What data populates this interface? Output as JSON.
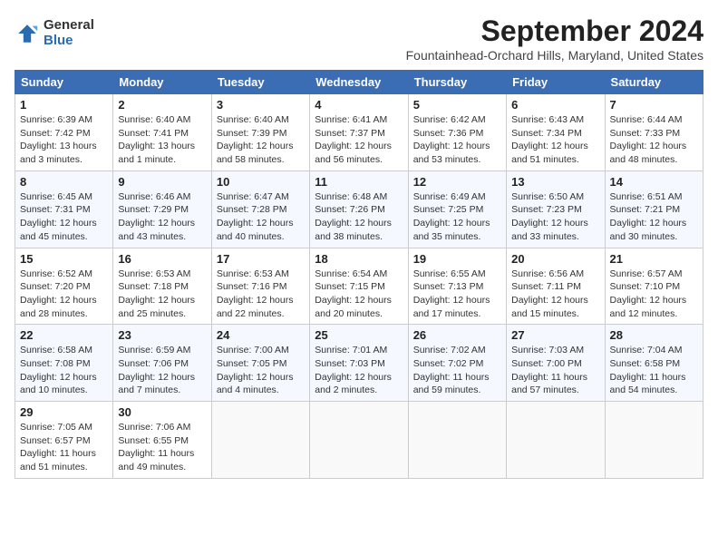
{
  "header": {
    "logo_general": "General",
    "logo_blue": "Blue",
    "title": "September 2024",
    "subtitle": "Fountainhead-Orchard Hills, Maryland, United States"
  },
  "days_of_week": [
    "Sunday",
    "Monday",
    "Tuesday",
    "Wednesday",
    "Thursday",
    "Friday",
    "Saturday"
  ],
  "weeks": [
    [
      {
        "day": "1",
        "info": "Sunrise: 6:39 AM\nSunset: 7:42 PM\nDaylight: 13 hours\nand 3 minutes."
      },
      {
        "day": "2",
        "info": "Sunrise: 6:40 AM\nSunset: 7:41 PM\nDaylight: 13 hours\nand 1 minute."
      },
      {
        "day": "3",
        "info": "Sunrise: 6:40 AM\nSunset: 7:39 PM\nDaylight: 12 hours\nand 58 minutes."
      },
      {
        "day": "4",
        "info": "Sunrise: 6:41 AM\nSunset: 7:37 PM\nDaylight: 12 hours\nand 56 minutes."
      },
      {
        "day": "5",
        "info": "Sunrise: 6:42 AM\nSunset: 7:36 PM\nDaylight: 12 hours\nand 53 minutes."
      },
      {
        "day": "6",
        "info": "Sunrise: 6:43 AM\nSunset: 7:34 PM\nDaylight: 12 hours\nand 51 minutes."
      },
      {
        "day": "7",
        "info": "Sunrise: 6:44 AM\nSunset: 7:33 PM\nDaylight: 12 hours\nand 48 minutes."
      }
    ],
    [
      {
        "day": "8",
        "info": "Sunrise: 6:45 AM\nSunset: 7:31 PM\nDaylight: 12 hours\nand 45 minutes."
      },
      {
        "day": "9",
        "info": "Sunrise: 6:46 AM\nSunset: 7:29 PM\nDaylight: 12 hours\nand 43 minutes."
      },
      {
        "day": "10",
        "info": "Sunrise: 6:47 AM\nSunset: 7:28 PM\nDaylight: 12 hours\nand 40 minutes."
      },
      {
        "day": "11",
        "info": "Sunrise: 6:48 AM\nSunset: 7:26 PM\nDaylight: 12 hours\nand 38 minutes."
      },
      {
        "day": "12",
        "info": "Sunrise: 6:49 AM\nSunset: 7:25 PM\nDaylight: 12 hours\nand 35 minutes."
      },
      {
        "day": "13",
        "info": "Sunrise: 6:50 AM\nSunset: 7:23 PM\nDaylight: 12 hours\nand 33 minutes."
      },
      {
        "day": "14",
        "info": "Sunrise: 6:51 AM\nSunset: 7:21 PM\nDaylight: 12 hours\nand 30 minutes."
      }
    ],
    [
      {
        "day": "15",
        "info": "Sunrise: 6:52 AM\nSunset: 7:20 PM\nDaylight: 12 hours\nand 28 minutes."
      },
      {
        "day": "16",
        "info": "Sunrise: 6:53 AM\nSunset: 7:18 PM\nDaylight: 12 hours\nand 25 minutes."
      },
      {
        "day": "17",
        "info": "Sunrise: 6:53 AM\nSunset: 7:16 PM\nDaylight: 12 hours\nand 22 minutes."
      },
      {
        "day": "18",
        "info": "Sunrise: 6:54 AM\nSunset: 7:15 PM\nDaylight: 12 hours\nand 20 minutes."
      },
      {
        "day": "19",
        "info": "Sunrise: 6:55 AM\nSunset: 7:13 PM\nDaylight: 12 hours\nand 17 minutes."
      },
      {
        "day": "20",
        "info": "Sunrise: 6:56 AM\nSunset: 7:11 PM\nDaylight: 12 hours\nand 15 minutes."
      },
      {
        "day": "21",
        "info": "Sunrise: 6:57 AM\nSunset: 7:10 PM\nDaylight: 12 hours\nand 12 minutes."
      }
    ],
    [
      {
        "day": "22",
        "info": "Sunrise: 6:58 AM\nSunset: 7:08 PM\nDaylight: 12 hours\nand 10 minutes."
      },
      {
        "day": "23",
        "info": "Sunrise: 6:59 AM\nSunset: 7:06 PM\nDaylight: 12 hours\nand 7 minutes."
      },
      {
        "day": "24",
        "info": "Sunrise: 7:00 AM\nSunset: 7:05 PM\nDaylight: 12 hours\nand 4 minutes."
      },
      {
        "day": "25",
        "info": "Sunrise: 7:01 AM\nSunset: 7:03 PM\nDaylight: 12 hours\nand 2 minutes."
      },
      {
        "day": "26",
        "info": "Sunrise: 7:02 AM\nSunset: 7:02 PM\nDaylight: 11 hours\nand 59 minutes."
      },
      {
        "day": "27",
        "info": "Sunrise: 7:03 AM\nSunset: 7:00 PM\nDaylight: 11 hours\nand 57 minutes."
      },
      {
        "day": "28",
        "info": "Sunrise: 7:04 AM\nSunset: 6:58 PM\nDaylight: 11 hours\nand 54 minutes."
      }
    ],
    [
      {
        "day": "29",
        "info": "Sunrise: 7:05 AM\nSunset: 6:57 PM\nDaylight: 11 hours\nand 51 minutes."
      },
      {
        "day": "30",
        "info": "Sunrise: 7:06 AM\nSunset: 6:55 PM\nDaylight: 11 hours\nand 49 minutes."
      },
      {
        "day": "",
        "info": ""
      },
      {
        "day": "",
        "info": ""
      },
      {
        "day": "",
        "info": ""
      },
      {
        "day": "",
        "info": ""
      },
      {
        "day": "",
        "info": ""
      }
    ]
  ]
}
